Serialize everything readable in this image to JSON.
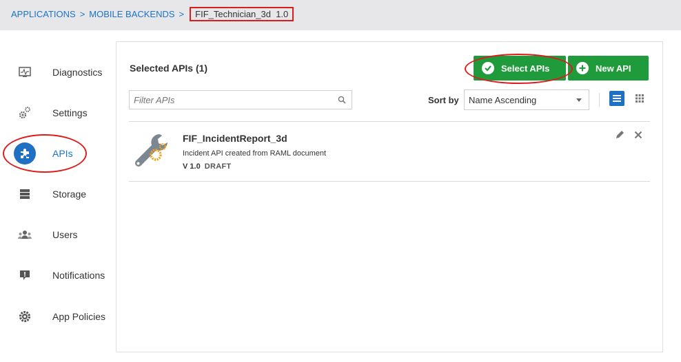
{
  "breadcrumb": {
    "items": [
      "APPLICATIONS",
      "MOBILE BACKENDS"
    ],
    "separator": ">",
    "current": "FIF_Technician_3d  1.0"
  },
  "sidebar": {
    "items": [
      {
        "label": "Diagnostics",
        "icon": "diagnostics-icon"
      },
      {
        "label": "Settings",
        "icon": "gears-icon"
      },
      {
        "label": "APIs",
        "icon": "puzzle-icon",
        "active": true
      },
      {
        "label": "Storage",
        "icon": "storage-icon"
      },
      {
        "label": "Users",
        "icon": "users-icon"
      },
      {
        "label": "Notifications",
        "icon": "notification-icon"
      },
      {
        "label": "App Policies",
        "icon": "gear-icon"
      }
    ]
  },
  "main": {
    "title": "Selected APIs (1)",
    "select_apis_label": "Select APIs",
    "new_api_label": "New API",
    "filter_placeholder": "Filter APIs",
    "sort_label": "Sort by",
    "sort_value": "Name Ascending",
    "apis": [
      {
        "name": "FIF_IncidentReport_3d",
        "description": "Incident API created from RAML document",
        "version": "V 1.0",
        "status": "DRAFT"
      }
    ]
  },
  "colors": {
    "accent_blue": "#1f6fc2",
    "button_green": "#1f9b3b",
    "highlight_red": "#e01a1a",
    "header_bg": "#e7e7e9"
  }
}
